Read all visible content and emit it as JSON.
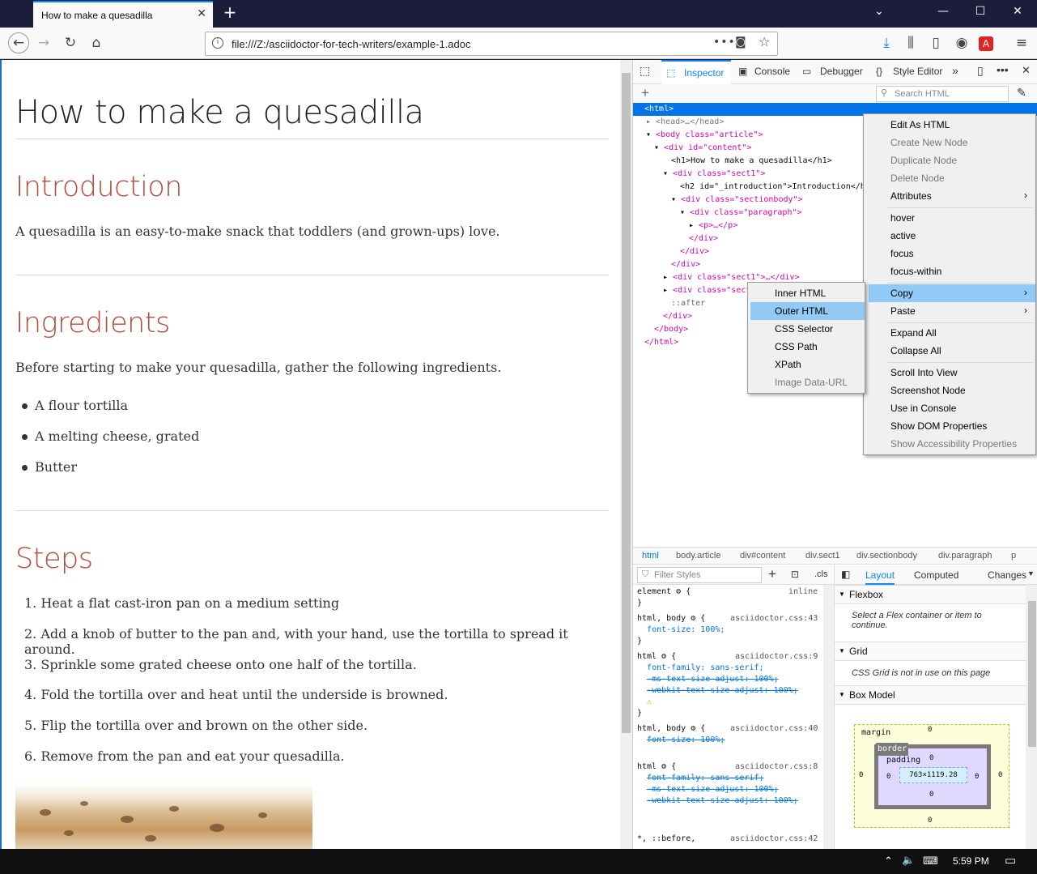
{
  "browser": {
    "tab_title": "How to make a quesadilla",
    "tab_close": "✕",
    "new_tab": "+",
    "url": "file:///Z:/asciidoctor-for-tech-writers/example-1.adoc",
    "window_buttons": {
      "chevron": "⌄",
      "minimize": "—",
      "maximize": "☐",
      "close": "✕"
    }
  },
  "article": {
    "title": "How to make a quesadilla",
    "intro_heading": "Introduction",
    "intro_text": "A quesadilla is an easy-to-make snack that toddlers (and grown-ups) love.",
    "ingredients_heading": "Ingredients",
    "ingredients_text": "Before starting to make your quesadilla, gather the following ingredients.",
    "ingredients": [
      "A flour tortilla",
      "A melting cheese, grated",
      "Butter"
    ],
    "steps_heading": "Steps",
    "steps": [
      "1. Heat a flat cast-iron pan on a medium setting",
      "2. Add a knob of butter to the pan and, with your hand, use the tortilla to spread it around.",
      "3. Sprinkle some grated cheese onto one half of the tortilla.",
      "4. Fold the tortilla over and heat until the underside is browned.",
      "5. Flip the tortilla over and brown on the other side.",
      "6. Remove from the pan and eat your quesadilla."
    ]
  },
  "devtools": {
    "tabs": {
      "inspector": "Inspector",
      "console": "Console",
      "debugger": "Debugger",
      "style_editor": "Style Editor"
    },
    "search_placeholder": "Search HTML",
    "markup": [
      "<html>",
      "<head>…</head>",
      "<body class=\"article\">",
      "<div id=\"content\">",
      "<h1>How to make a quesadilla</h1>",
      "<div class=\"sect1\">",
      "<h2 id=\"_introduction\">Introduction</h",
      "<div class=\"sectionbody\">",
      "<div class=\"paragraph\">",
      "<p>…</p>",
      "</div>",
      "</div>",
      "</div>",
      "<div class=\"sect1\">…</div>",
      "<div class=\"sect",
      "::after",
      "</div>",
      "</body>",
      "</html>"
    ],
    "breadcrumbs": [
      "html",
      "body.article",
      "div#content",
      "div.sect1",
      "div.sectionbody",
      "div.paragraph",
      "p"
    ],
    "filter_placeholder": "Filter Styles",
    "cls": ".cls",
    "layout_tabs": [
      "Layout",
      "Computed",
      "Changes"
    ],
    "rules": [
      {
        "selector": "element",
        "source": "inline"
      },
      {
        "selector": "html, body",
        "source": "asciidoctor.css:43",
        "decls": [
          "font-size: 100%;"
        ]
      },
      {
        "selector": "html",
        "source": "asciidoctor.css:9",
        "decls": [
          "font-family: sans-serif;",
          "-ms-text-size-adjust: 100%;",
          "-webkit-text-size-adjust: 100%;"
        ]
      },
      {
        "selector": "html, body",
        "source": "asciidoctor.css:40",
        "decls": [
          "font-size: 100%;"
        ]
      },
      {
        "selector": "html",
        "source": "asciidoctor.css:8",
        "decls": [
          "font-family: sans-serif;",
          "-ms-text-size-adjust: 100%;",
          "-webkit-text-size-adjust: 100%;"
        ]
      },
      {
        "selector": "*, ::before,",
        "source": "asciidoctor.css:42"
      }
    ],
    "layout": {
      "flexbox": "Flexbox",
      "flexbox_note": "Select a Flex container or item to continue.",
      "grid": "Grid",
      "grid_note": "CSS Grid is not in use on this page",
      "box_model": "Box Model",
      "box": {
        "margin": "margin",
        "border": "border",
        "padding": "padding",
        "size": "763×1119.28",
        "zero": "0"
      }
    }
  },
  "context_menu": [
    {
      "label": "Edit As HTML",
      "disabled": false
    },
    {
      "label": "Create New Node",
      "disabled": true
    },
    {
      "label": "Duplicate Node",
      "disabled": true
    },
    {
      "label": "Delete Node",
      "disabled": true
    },
    {
      "label": "Attributes",
      "disabled": false,
      "submenu": true
    },
    {
      "label": "hover"
    },
    {
      "label": "active"
    },
    {
      "label": "focus"
    },
    {
      "label": "focus-within"
    },
    {
      "label": "Copy",
      "submenu": true,
      "selected": true
    },
    {
      "label": "Paste",
      "submenu": true
    },
    {
      "label": "Expand All"
    },
    {
      "label": "Collapse All"
    },
    {
      "label": "Scroll Into View"
    },
    {
      "label": "Screenshot Node"
    },
    {
      "label": "Use in Console"
    },
    {
      "label": "Show DOM Properties"
    },
    {
      "label": "Show Accessibility Properties",
      "disabled": true
    }
  ],
  "copy_submenu": [
    {
      "label": "Inner HTML"
    },
    {
      "label": "Outer HTML",
      "selected": true
    },
    {
      "label": "CSS Selector"
    },
    {
      "label": "CSS Path"
    },
    {
      "label": "XPath"
    },
    {
      "label": "Image Data-URL",
      "disabled": true
    }
  ],
  "taskbar": {
    "time": "5:59 PM"
  },
  "colors": {
    "accent": "#0a84ff",
    "heading": "#b94a3b",
    "selection": "#0074e8"
  }
}
